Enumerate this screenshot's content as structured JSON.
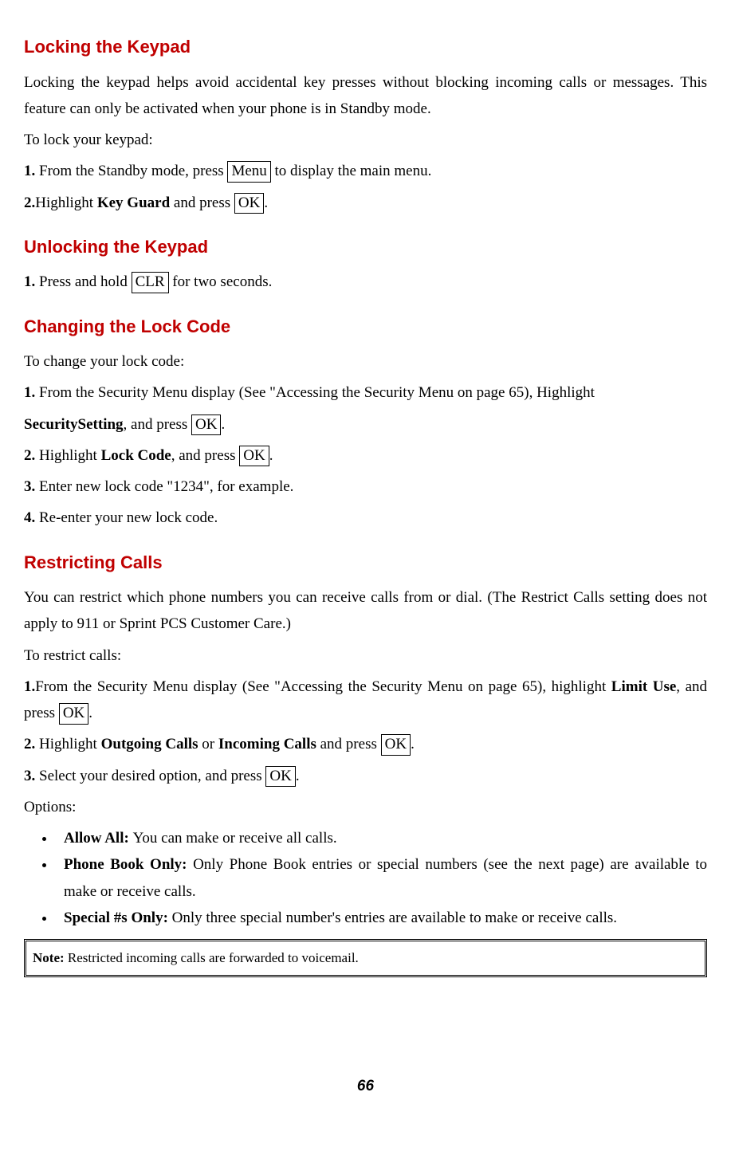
{
  "headings": {
    "locking": "Locking the Keypad",
    "unlocking": "Unlocking the Keypad",
    "changing": "Changing the Lock Code",
    "restricting": "Restricting Calls"
  },
  "locking": {
    "intro": "Locking the keypad helps avoid accidental key presses without blocking incoming calls or messages. This feature can only be activated when your phone is in Standby mode.",
    "toLock": "To lock your keypad:",
    "step1_a": "1. ",
    "step1_b": "From the Standby mode, press ",
    "step1_key": "Menu",
    "step1_c": " to display the main menu.",
    "step2_a": "2.",
    "step2_b": "Highlight ",
    "step2_bold": "Key Guard",
    "step2_c": " and press ",
    "step2_key": "OK",
    "step2_d": "."
  },
  "unlocking": {
    "step1_a": "1. ",
    "step1_b": "Press and hold ",
    "step1_key": "CLR",
    "step1_c": " for two seconds."
  },
  "changing": {
    "intro": "To change your lock code:",
    "step1_a": "1. ",
    "step1_b": "From the  Security Menu display (See  \"Accessing the Security Menu on page 65), Highlight",
    "step1_bold": "SecuritySetting",
    "step1_c": ", and press ",
    "step1_key": "OK",
    "step1_d": ".",
    "step2_a": "2. ",
    "step2_b": "Highlight ",
    "step2_bold": "Lock Code",
    "step2_c": ", and press ",
    "step2_key": "OK",
    "step2_d": ".",
    "step3_a": "3. ",
    "step3_b": "Enter new lock code \"1234\", for example.",
    "step4_a": "4. ",
    "step4_b": "Re-enter your new lock code."
  },
  "restricting": {
    "intro": "You can restrict which phone numbers you can receive calls from or dial. (The Restrict Calls setting does not apply to 911 or Sprint PCS Customer Care.)",
    "toRestrict": "To restrict calls:",
    "step1_a": "1.",
    "step1_b": "From the  Security Menu display (See  \"Accessing the Security Menu on page 65), highlight ",
    "step1_bold": "Limit Use",
    "step1_c": ", and press ",
    "step1_key": "OK",
    "step1_d": ".",
    "step2_a": "2. ",
    "step2_b": "Highlight ",
    "step2_bold1": "Outgoing Calls",
    "step2_c": " or ",
    "step2_bold2": "Incoming Calls",
    "step2_d": " and press ",
    "step2_key": "OK",
    "step2_e": ".",
    "step3_a": "3. ",
    "step3_b": "Select your desired option, and press ",
    "step3_key": "OK",
    "step3_c": ".",
    "options": "Options:",
    "bullet1_bold": "Allow All: ",
    "bullet1_text": "You can make or receive all calls.",
    "bullet2_bold": "Phone Book Only: ",
    "bullet2_text": "Only Phone Book entries or special numbers (see the next page) are available to make or receive calls.",
    "bullet3_bold": "Special #s Only: ",
    "bullet3_text": "Only three special number's entries are available to make or receive calls."
  },
  "note": {
    "bold": "Note: ",
    "text": "Restricted incoming calls are forwarded to voicemail."
  },
  "pageNum": "66"
}
